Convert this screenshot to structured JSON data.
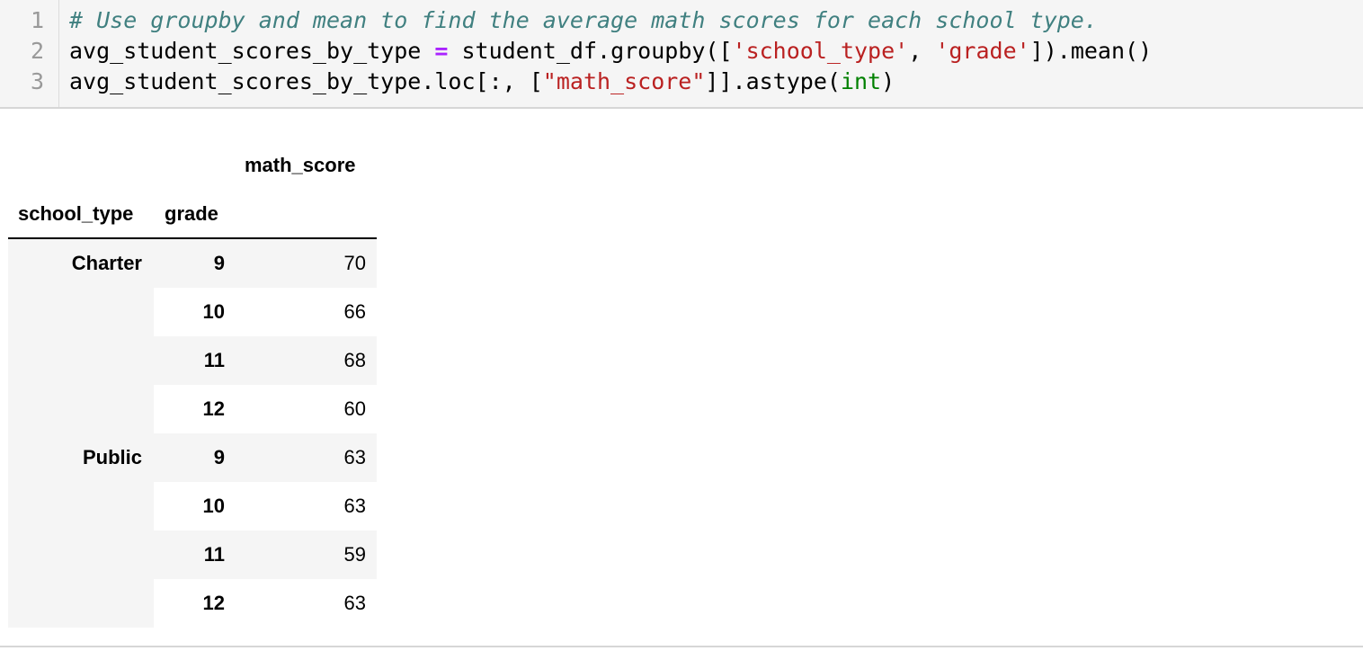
{
  "code_cell": {
    "line_numbers": [
      "1",
      "2",
      "3"
    ],
    "line1": {
      "comment": "# Use groupby and mean to find the average math scores for each school type."
    },
    "line2": {
      "var": "avg_student_scores_by_type ",
      "op": "=",
      "call": " student_df.groupby([",
      "str1": "'school_type'",
      "sep": ", ",
      "str2": "'grade'",
      "tail": "]).mean()"
    },
    "line3": {
      "head": "avg_student_scores_by_type.loc[:, [",
      "str": "\"math_score\"",
      "mid": "]].astype(",
      "builtin": "int",
      "tail": ")"
    }
  },
  "dataframe": {
    "value_column": "math_score",
    "index_names": [
      "school_type",
      "grade"
    ],
    "rows": [
      {
        "school_type": "Charter",
        "grade": "9",
        "math_score": "70"
      },
      {
        "school_type": "",
        "grade": "10",
        "math_score": "66"
      },
      {
        "school_type": "",
        "grade": "11",
        "math_score": "68"
      },
      {
        "school_type": "",
        "grade": "12",
        "math_score": "60"
      },
      {
        "school_type": "Public",
        "grade": "9",
        "math_score": "63"
      },
      {
        "school_type": "",
        "grade": "10",
        "math_score": "63"
      },
      {
        "school_type": "",
        "grade": "11",
        "math_score": "59"
      },
      {
        "school_type": "",
        "grade": "12",
        "math_score": "63"
      }
    ]
  }
}
